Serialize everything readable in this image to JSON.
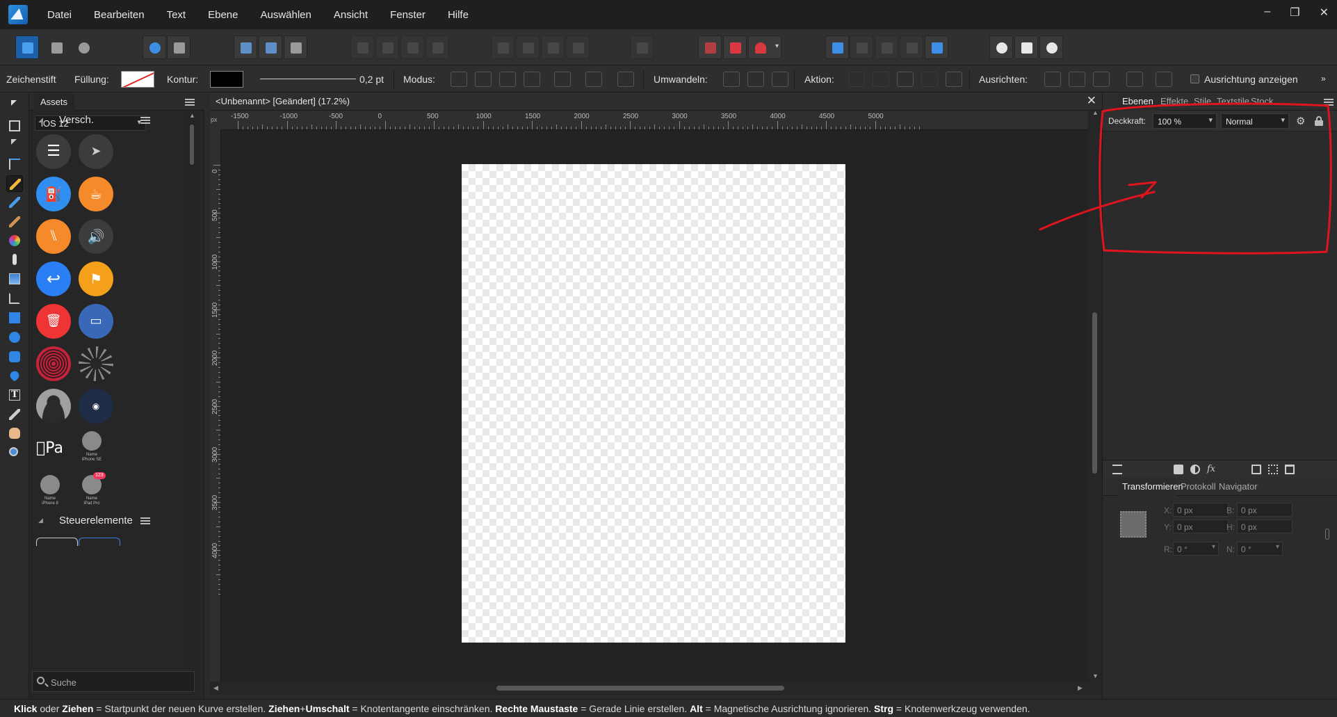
{
  "menubar": {
    "items": [
      "Datei",
      "Bearbeiten",
      "Text",
      "Ebene",
      "Auswählen",
      "Ansicht",
      "Fenster",
      "Hilfe"
    ],
    "window_controls": [
      "–",
      "❐",
      "✕"
    ]
  },
  "context_bar": {
    "tool_name": "Zeichenstift",
    "fill_label": "Füllung:",
    "stroke_label": "Kontur:",
    "stroke_width": "0,2 pt",
    "mode_label": "Modus:",
    "convert_label": "Umwandeln:",
    "action_label": "Aktion:",
    "align_label": "Ausrichten:",
    "show_alignment_label": "Ausrichtung anzeigen",
    "show_alignment_checked": false,
    "fill_color": "none",
    "stroke_color": "#000000"
  },
  "assets_panel": {
    "tab": "Assets",
    "selected_set": "iOS 12",
    "category_1": "Versch.",
    "category_2": "Steuerelemente",
    "search_placeholder": "Suche",
    "items": [
      {
        "icon": "list-icon",
        "color": "#3c3c3c"
      },
      {
        "icon": "location-arrow-icon",
        "color": "#3c3c3c"
      },
      {
        "icon": "fuel-icon",
        "color": "#2f8ef0"
      },
      {
        "icon": "coffee-icon",
        "color": "#f58a2a"
      },
      {
        "icon": "fork-knife-icon",
        "color": "#f58a2a"
      },
      {
        "icon": "speaker-icon",
        "color": "#3c3c3c"
      },
      {
        "icon": "reply-icon",
        "color": "#2a7ff5"
      },
      {
        "icon": "flag-icon",
        "color": "#f5a01a"
      },
      {
        "icon": "trash-icon",
        "color": "#ee3434"
      },
      {
        "icon": "archive-icon",
        "color": "#3a68b8"
      },
      {
        "icon": "fingerprint-icon",
        "color": "#c4233a"
      },
      {
        "icon": "spinner-icon",
        "color": "#262626"
      },
      {
        "icon": "avatar-icon",
        "color": "#9a9a9a"
      },
      {
        "icon": "radio-dot-icon",
        "color": "#1e2c48"
      },
      {
        "icon": "apple-pay-icon",
        "color": "#262626"
      },
      {
        "icon": "contact-iphone-se-icon",
        "color": "#8a8a8a"
      },
      {
        "icon": "contact-iphone-8-icon",
        "color": "#8a8a8a"
      },
      {
        "icon": "contact-ipad-pro-icon",
        "color": "#8a8a8a"
      }
    ],
    "captions": {
      "iphone_se": "Name\niPhone SE",
      "iphone_8": "Name\niPhone 8",
      "ipad_pro": "Name\niPad Pro",
      "badge": "123",
      "apple_pay": "Pa"
    }
  },
  "document": {
    "title": "<Unbenannt> [Geändert] (17.2%)",
    "ruler_unit": "px",
    "ruler_h_labels": [
      "-1500",
      "-1000",
      "-500",
      "0",
      "500",
      "1000",
      "1500",
      "2000",
      "2500",
      "3000",
      "3500",
      "4000",
      "4500",
      "5000"
    ],
    "ruler_v_labels": [
      "0",
      "500",
      "1000",
      "1500",
      "2000",
      "2500",
      "3000",
      "3500",
      "4000"
    ]
  },
  "studio": {
    "tabs": [
      "Ebenen",
      "Effekte",
      "Stile",
      "Textstile",
      "Stock"
    ],
    "active_tab": "Ebenen",
    "opacity_label": "Deckkraft:",
    "opacity_value": "100 %",
    "blend_mode": "Normal",
    "lower_tabs": [
      "Transformieren",
      "Protokoll",
      "Navigator"
    ],
    "active_lower_tab": "Transformieren",
    "transform": {
      "x_label": "X:",
      "x_value": "0 px",
      "y_label": "Y:",
      "y_value": "0 px",
      "w_label": "B:",
      "w_value": "0 px",
      "h_label": "H:",
      "h_value": "0 px",
      "r_label": "R:",
      "r_value": "0 °",
      "s_label": "N:",
      "s_value": "0 °"
    }
  },
  "statusbar": {
    "parts": [
      {
        "b": "Klick"
      },
      {
        "t": " oder "
      },
      {
        "b": "Ziehen"
      },
      {
        "t": " = Startpunkt der neuen Kurve erstellen. "
      },
      {
        "b": "Ziehen"
      },
      {
        "t": "+"
      },
      {
        "b": "Umschalt"
      },
      {
        "t": " = Knotentangente einschränken. "
      },
      {
        "b": "Rechte Maustaste"
      },
      {
        "t": " = Gerade Linie erstellen. "
      },
      {
        "b": "Alt"
      },
      {
        "t": " = Magnetische Ausrichtung ignorieren. "
      },
      {
        "b": "Strg"
      },
      {
        "t": " = Knotenwerkzeug verwenden."
      }
    ]
  },
  "colors": {
    "accent_blue": "#3d8fe6",
    "annotation_red": "#e0141e",
    "panel_bg": "#2b2b2b",
    "canvas_bg": "#232323"
  }
}
